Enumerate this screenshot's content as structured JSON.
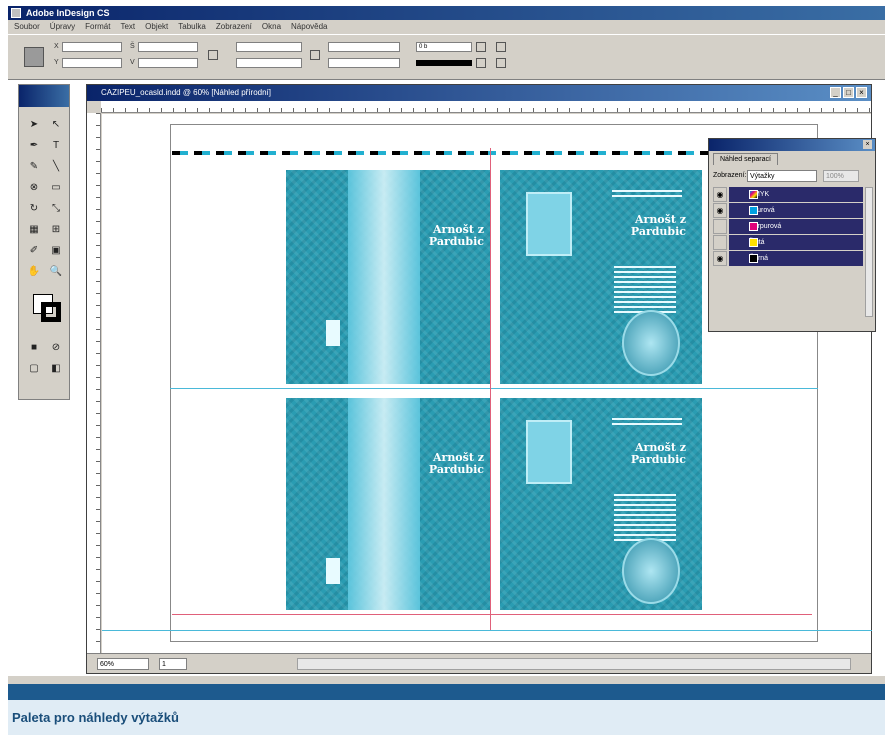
{
  "app": {
    "title": "Adobe InDesign CS"
  },
  "menu": [
    "Soubor",
    "Úpravy",
    "Formát",
    "Text",
    "Objekt",
    "Tabulka",
    "Zobrazení",
    "Okna",
    "Nápověda"
  ],
  "control_panel": {
    "stroke_weight": "0 b"
  },
  "document": {
    "title": "CAZIPEU_ocasld.indd @ 60% [Náhled přírodní]",
    "zoom": "60%",
    "page": "1"
  },
  "panels": {
    "left_title": "Arnošt z Pardubic",
    "right_title": "Arnošt z Pardubic"
  },
  "separations": {
    "tab": "Náhled separací",
    "view_label": "Zobrazení:",
    "view_value": "Výtažky",
    "percent": "100%",
    "items": [
      {
        "name": "CMYK",
        "color": "#2a2a2a",
        "eye": true
      },
      {
        "name": "Azurová",
        "color": "#00a0e0",
        "eye": true
      },
      {
        "name": "Purpurová",
        "color": "#e0007a",
        "eye": false
      },
      {
        "name": "Žlutá",
        "color": "#ffe000",
        "eye": false
      },
      {
        "name": "Černá",
        "color": "#000000",
        "eye": true
      }
    ]
  },
  "caption": "Paleta pro náhledy výtažků"
}
